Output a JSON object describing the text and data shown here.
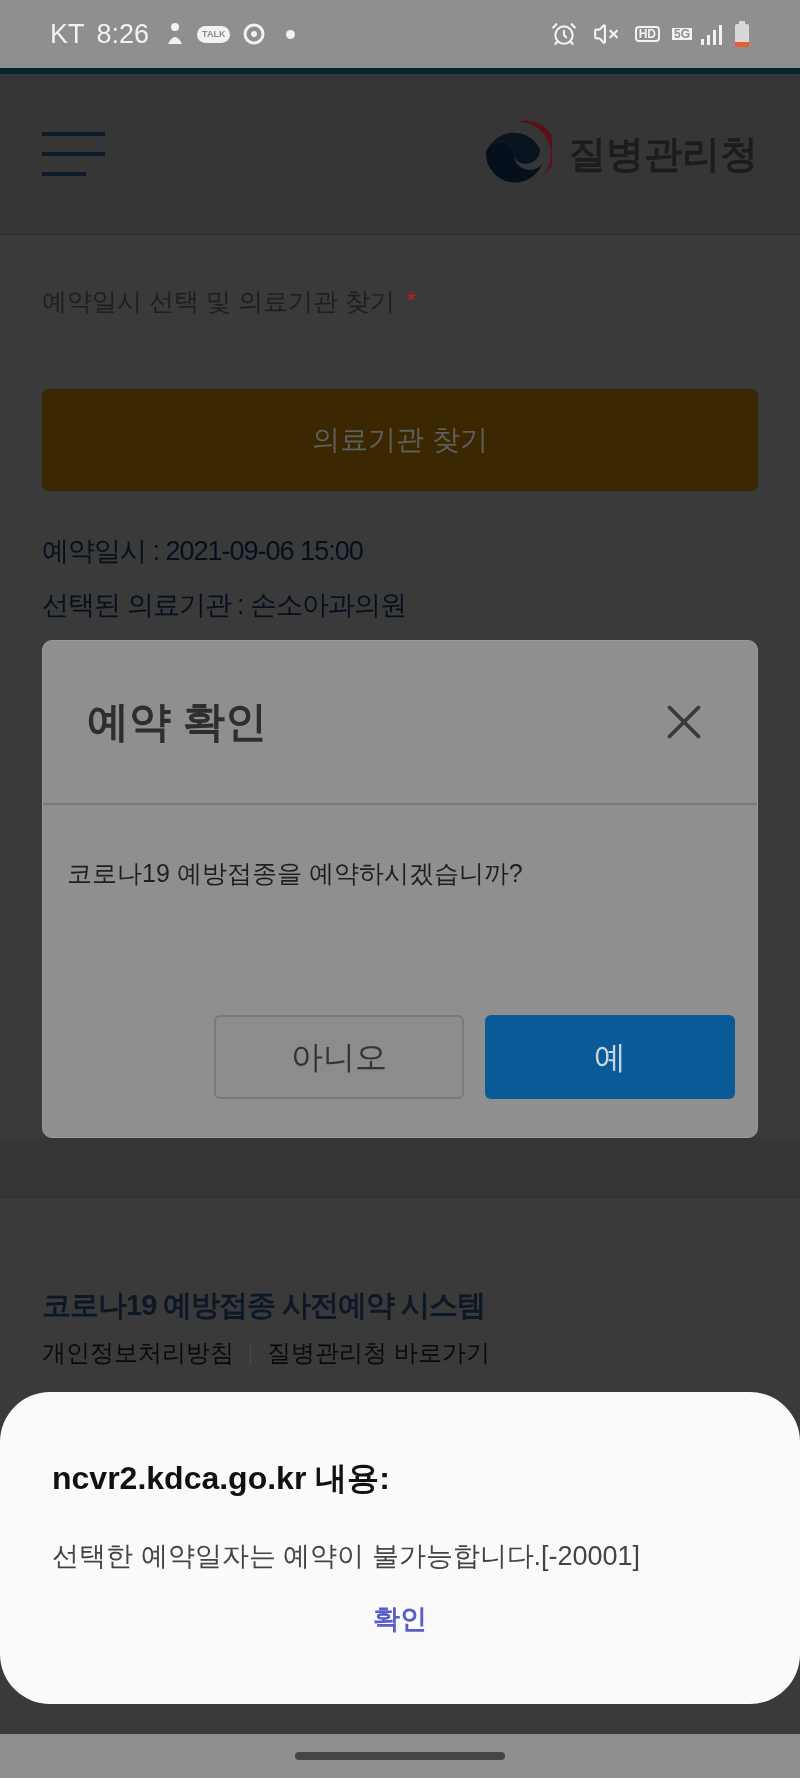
{
  "status_bar": {
    "carrier": "KT",
    "time": "8:26",
    "talk_badge": "TALK",
    "hd_badge": "HD",
    "network": "5G"
  },
  "header": {
    "agency_name": "질병관리청"
  },
  "form": {
    "label": "예약일시 선택 및 의료기관 찾기",
    "required_mark": "*",
    "find_button": "의료기관 찾기",
    "reservation_time": "예약일시 : 2021-09-06 15:00",
    "selected_clinic": "선택된 의료기관 : 손소아과의원"
  },
  "confirm_dialog": {
    "title": "예약 확인",
    "message": "코로나19 예방접종을 예약하시겠습니까?",
    "buttons": [
      {
        "label": "아니오",
        "kind": "secondary"
      },
      {
        "label": "예",
        "kind": "primary"
      }
    ]
  },
  "footer": {
    "title": "코로나19 예방접종 사전예약 시스템",
    "links": [
      "개인정보처리방침",
      "질병관리청 바로가기"
    ]
  },
  "alert": {
    "title": "ncvr2.kdca.go.kr 내용:",
    "message": "선택한 예약일자는 예약이 불가능합니다.[-20001]",
    "ok_button": "확인"
  }
}
